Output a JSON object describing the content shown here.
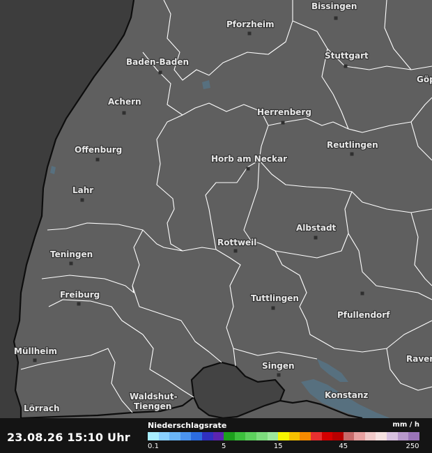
{
  "map": {
    "cities": [
      {
        "name": "Bissingen"
      },
      {
        "name": "Pforzheim"
      },
      {
        "name": "Stuttgart"
      },
      {
        "name": "Göp"
      },
      {
        "name": "Baden-Baden"
      },
      {
        "name": "Achern"
      },
      {
        "name": "Herrenberg"
      },
      {
        "name": "Offenburg"
      },
      {
        "name": "Reutlingen"
      },
      {
        "name": "Horb am Neckar"
      },
      {
        "name": "Lahr"
      },
      {
        "name": "Albstadt"
      },
      {
        "name": "Rottweil"
      },
      {
        "name": "Teningen"
      },
      {
        "name": "Freiburg"
      },
      {
        "name": "Tuttlingen"
      },
      {
        "name": "Pfullendorf"
      },
      {
        "name": "Müllheim"
      },
      {
        "name": "Singen"
      },
      {
        "name": "Raven"
      },
      {
        "name": "Waldshut-\nTiengen"
      },
      {
        "name": "Konstanz"
      },
      {
        "name": "Lörrach"
      }
    ],
    "colors": {
      "land": "#5f5f5f",
      "outside": "#3d3d3d",
      "switzerland_enclave": "#434343",
      "border_inner": "#ffffff",
      "border_outer": "#0d0d0d",
      "water": "#57707f"
    }
  },
  "footer": {
    "timestamp": "23.08.26 15:10 Uhr",
    "legend_title": "Niederschlagsrate",
    "legend_unit": "mm / h",
    "legend_colors": [
      "#a8eeff",
      "#8ad0ff",
      "#6ab4f5",
      "#4b94f0",
      "#2c6ce0",
      "#3030c0",
      "#5c24b0",
      "#1ca01c",
      "#3cc03c",
      "#5cd05c",
      "#7cdc7c",
      "#9ce89c",
      "#f5f500",
      "#f5c000",
      "#f58a00",
      "#e83030",
      "#d40000",
      "#b80000",
      "#c86a6a",
      "#e8a0a0",
      "#f0c8c8",
      "#f5e0e0",
      "#d8c0e0",
      "#b898cc",
      "#9a74b8"
    ],
    "legend_ticks": [
      {
        "label": "0.1",
        "value": 0.1
      },
      {
        "label": "5",
        "value": 5
      },
      {
        "label": "15",
        "value": 15
      },
      {
        "label": "45",
        "value": 45
      },
      {
        "label": "250",
        "value": 250
      }
    ]
  }
}
